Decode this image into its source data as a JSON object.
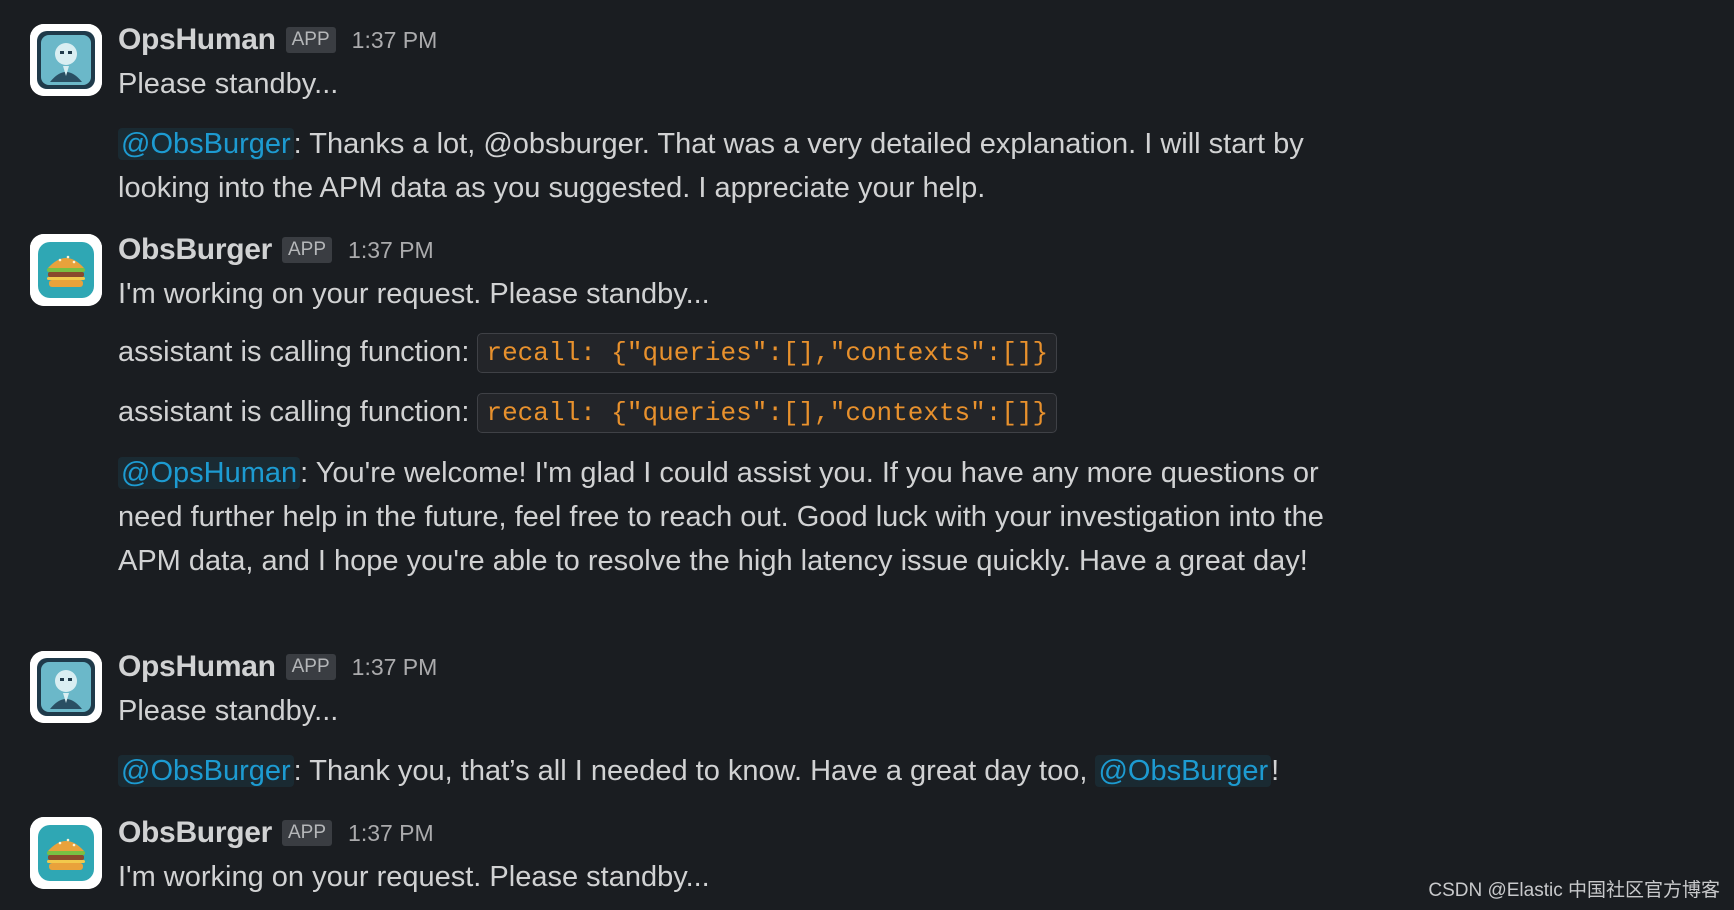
{
  "messages": [
    {
      "author": "OpsHuman",
      "badge": "APP",
      "time": "1:37 PM",
      "avatar_icon": "robot-portrait-icon",
      "status": "Please standby...",
      "mention": "@ObsBurger",
      "text_after_mention": ": Thanks a lot, @obsburger. That was a very detailed explanation. I will start by looking into the APM data as you suggested. I appreciate your help."
    },
    {
      "author": "ObsBurger",
      "badge": "APP",
      "time": "1:37 PM",
      "avatar_icon": "burger-icon",
      "status": "I'm working on your request. Please standby...",
      "function_calls": [
        {
          "label": "assistant is calling function:",
          "code": "recall: {\"queries\":[],\"contexts\":[]}"
        },
        {
          "label": "assistant is calling function:",
          "code": "recall: {\"queries\":[],\"contexts\":[]}"
        }
      ],
      "mention": "@OpsHuman",
      "text_after_mention": ": You're welcome! I'm glad I could assist you. If you have any more questions or need further help in the future, feel free to reach out. Good luck with your investigation into the APM data, and I hope you're able to resolve the high latency issue quickly. Have a great day!"
    },
    {
      "author": "OpsHuman",
      "badge": "APP",
      "time": "1:37 PM",
      "avatar_icon": "robot-portrait-icon",
      "status": "Please standby...",
      "mention": "@ObsBurger",
      "text_after_mention": ": Thank you, that’s all I needed to know. Have a great day too, ",
      "mention_2": "@ObsBurger",
      "text_end": "!"
    },
    {
      "author": "ObsBurger",
      "badge": "APP",
      "time": "1:37 PM",
      "avatar_icon": "burger-icon",
      "status": "I'm working on your request. Please standby..."
    }
  ],
  "watermark": "CSDN @Elastic 中国社区官方博客",
  "colors": {
    "background": "#1a1d21",
    "text": "#d1d2d3",
    "mention": "#1d9bd1",
    "code": "#e8912d"
  }
}
